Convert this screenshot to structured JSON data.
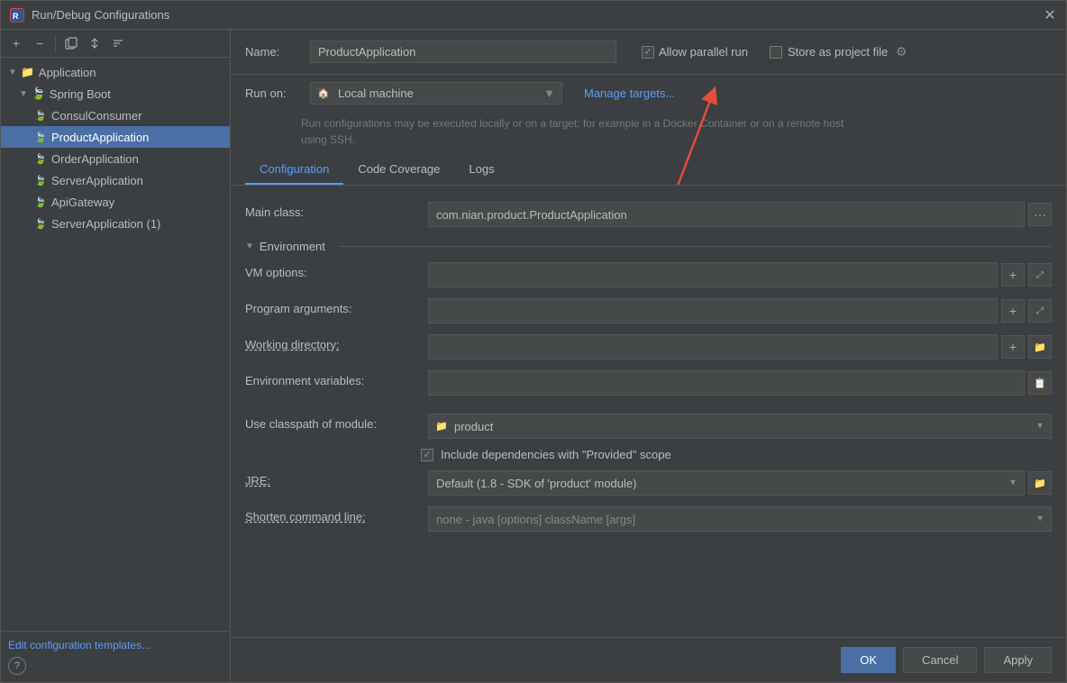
{
  "titlebar": {
    "title": "Run/Debug Configurations",
    "icon": "R"
  },
  "toolbar": {
    "add_label": "+",
    "remove_label": "−",
    "copy_label": "⧉",
    "move_up_label": "↑",
    "sort_label": "⇅"
  },
  "tree": {
    "items": [
      {
        "id": "application",
        "label": "Application",
        "indent": 0,
        "type": "folder",
        "arrow": "▼",
        "selected": false
      },
      {
        "id": "spring-boot",
        "label": "Spring Boot",
        "indent": 1,
        "type": "folder",
        "arrow": "▼",
        "selected": false
      },
      {
        "id": "consul-consumer",
        "label": "ConsulConsumer",
        "indent": 2,
        "type": "app",
        "selected": false
      },
      {
        "id": "product-application",
        "label": "ProductApplication",
        "indent": 2,
        "type": "app",
        "selected": true
      },
      {
        "id": "order-application",
        "label": "OrderApplication",
        "indent": 2,
        "type": "app",
        "selected": false
      },
      {
        "id": "server-application-1",
        "label": "ServerApplication",
        "indent": 2,
        "type": "app",
        "selected": false
      },
      {
        "id": "api-gateway",
        "label": "ApiGateway",
        "indent": 2,
        "type": "app",
        "selected": false
      },
      {
        "id": "server-application-2",
        "label": "ServerApplication (1)",
        "indent": 2,
        "type": "app",
        "selected": false
      }
    ],
    "edit_templates": "Edit configuration templates..."
  },
  "form": {
    "name_label": "Name:",
    "name_value": "ProductApplication",
    "allow_parallel_run_label": "Allow parallel run",
    "allow_parallel_run_checked": true,
    "store_as_project_file_label": "Store as project file",
    "store_as_project_file_checked": false,
    "run_on_label": "Run on:",
    "run_on_value": "Local machine",
    "run_on_options": [
      "Local machine"
    ],
    "manage_targets_label": "Manage targets...",
    "run_desc": "Run configurations may be executed locally or on a target: for example in a Docker Container or on a remote host using SSH.",
    "tabs": [
      {
        "id": "configuration",
        "label": "Configuration",
        "active": true
      },
      {
        "id": "code-coverage",
        "label": "Code Coverage",
        "active": false
      },
      {
        "id": "logs",
        "label": "Logs",
        "active": false
      }
    ],
    "main_class_label": "Main class:",
    "main_class_value": "com.nian.product.ProductApplication",
    "environment_label": "Environment",
    "vm_options_label": "VM options:",
    "vm_options_value": "",
    "program_args_label": "Program arguments:",
    "program_args_value": "",
    "working_dir_label": "Working directory:",
    "working_dir_value": "",
    "env_vars_label": "Environment variables:",
    "env_vars_value": "",
    "classpath_label": "Use classpath of module:",
    "classpath_value": "product",
    "classpath_options": [
      "product"
    ],
    "include_deps_label": "Include dependencies with \"Provided\" scope",
    "include_deps_checked": true,
    "jre_label": "JRE:",
    "jre_value": "Default (1.8 - SDK of 'product' module)",
    "jre_options": [
      "Default (1.8 - SDK of 'product' module)"
    ],
    "shorten_cmd_label": "Shorten command line:",
    "shorten_cmd_value": "none - java [options] className [args]",
    "shorten_cmd_options": [
      "none - java [options] className [args]"
    ]
  },
  "footer": {
    "ok_label": "OK",
    "cancel_label": "Cancel",
    "apply_label": "Apply"
  },
  "help": "?"
}
